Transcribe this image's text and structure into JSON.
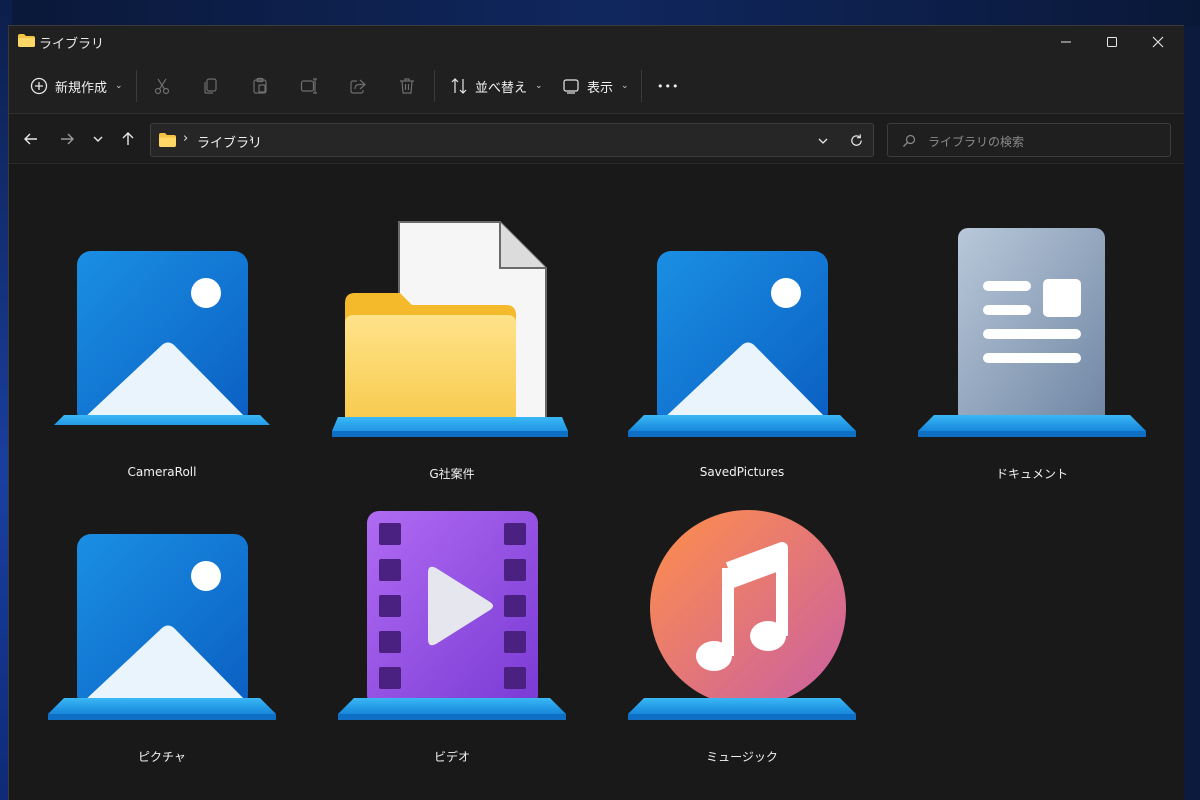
{
  "window": {
    "title": "ライブラリ"
  },
  "toolbar": {
    "new_label": "新規作成",
    "sort_label": "並べ替え",
    "view_label": "表示",
    "more_label": "•••"
  },
  "address": {
    "path": "ライブラリ",
    "separator": "›"
  },
  "search": {
    "placeholder": "ライブラリの検索"
  },
  "items": [
    {
      "label": "CameraRoll",
      "icon": "pictures-library-icon"
    },
    {
      "label": "G社案件",
      "icon": "folder-document-icon"
    },
    {
      "label": "SavedPictures",
      "icon": "pictures-library-icon"
    },
    {
      "label": "ドキュメント",
      "icon": "documents-library-icon"
    },
    {
      "label": "ピクチャ",
      "icon": "pictures-library-icon"
    },
    {
      "label": "ビデオ",
      "icon": "videos-library-icon"
    },
    {
      "label": "ミュージック",
      "icon": "music-library-icon"
    }
  ],
  "colors": {
    "window_bg": "#191919",
    "toolbar_bg": "#202020",
    "library_blue": "#1a8ce0",
    "folder_yellow": "#ffd766"
  }
}
